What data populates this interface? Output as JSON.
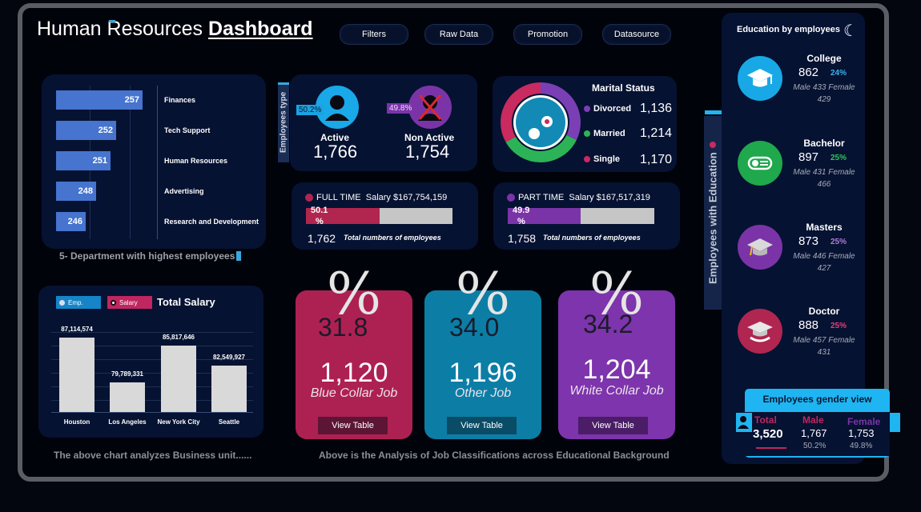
{
  "header": {
    "title_plain": "Human Resources",
    "title_bold": "Dashboard",
    "nav": [
      {
        "label": "Filters"
      },
      {
        "label": "Raw Data"
      },
      {
        "label": "Promotion"
      },
      {
        "label": "Datasource"
      }
    ]
  },
  "departments": {
    "caption": "5- Department with highest employees",
    "items": [
      {
        "name": "Finances",
        "value": "257",
        "count": 257
      },
      {
        "name": "Tech Support",
        "value": "252",
        "count": 252
      },
      {
        "name": "Human Resources",
        "value": "251",
        "count": 251
      },
      {
        "name": "Advertising",
        "value": "248",
        "count": 248
      },
      {
        "name": "Research and Development",
        "value": "246",
        "count": 246
      }
    ]
  },
  "salary_chart": {
    "legend_emp": "Emp.",
    "legend_salary": "Salary",
    "title": "Total Salary",
    "caption": "The above chart analyzes Business unit......"
  },
  "chart_data": {
    "type": "bar",
    "title": "Total Salary",
    "categories": [
      "Houston",
      "Los Angeles",
      "New York City",
      "Seattle"
    ],
    "values": [
      87114574,
      79789331,
      85817646,
      82549927
    ],
    "value_labels": [
      "87,114,574",
      "79,789,331",
      "85,817,646",
      "82,549,927"
    ],
    "ylim": [
      75000000,
      88000000
    ],
    "grid": true
  },
  "employee_type": {
    "tab": "Employees type",
    "active": {
      "label": "Active",
      "value": "1,766",
      "pct": "50.2%"
    },
    "non_active": {
      "label": "Non Active",
      "value": "1,754",
      "pct": "49.8%"
    }
  },
  "marital": {
    "title": "Marital Status",
    "items": [
      {
        "label": "Divorced",
        "value": "1,136",
        "color": "#7b3fb5"
      },
      {
        "label": "Married",
        "value": "1,214",
        "color": "#2db357"
      },
      {
        "label": "Single",
        "value": "1,170",
        "color": "#c92a5f"
      }
    ]
  },
  "full_time": {
    "label": "FULL TIME",
    "salary": "Salary $167,754,159",
    "pct": "50.1",
    "pct_sign": "%",
    "fraction": 0.501,
    "count": "1,762",
    "count_label": "Total numbers of employees",
    "color": "#b0264f"
  },
  "part_time": {
    "label": "PART TIME",
    "salary": "Salary $167,517,319",
    "pct": "49.9",
    "pct_sign": "%",
    "fraction": 0.499,
    "count": "1,758",
    "count_label": "Total numbers of employees",
    "color": "#7a34a8"
  },
  "jobs": {
    "caption": "Above is the Analysis of Job Classifications across Educational Background",
    "symbol": "%",
    "cards": [
      {
        "pct": "31.8",
        "count": "1,120",
        "label": "Blue Collar Job",
        "button": "View Table",
        "color": "#ad2152"
      },
      {
        "pct": "34.0",
        "count": "1,196",
        "label": "Other Job",
        "button": "View Table",
        "color": "#0c7ea6"
      },
      {
        "pct": "34.2",
        "count": "1,204",
        "label": "White Collar Job",
        "button": "View Table",
        "color": "#7d34ac"
      }
    ]
  },
  "education": {
    "title": "Education by employees",
    "tab": "Employees with Education",
    "items": [
      {
        "name": "College",
        "count": "862",
        "pct": "24%",
        "gender": "Male 433 Female 429",
        "color": "#18a8e6",
        "pct_color": "#3ab4ee"
      },
      {
        "name": "Bachelor",
        "count": "897",
        "pct": "25%",
        "gender": "Male 431 Female 466",
        "color": "#1fa84c",
        "pct_color": "#2fc45c"
      },
      {
        "name": "Masters",
        "count": "873",
        "pct": "25%",
        "gender": "Male 446 Female 427",
        "color": "#7a34a8",
        "pct_color": "#b07ad8"
      },
      {
        "name": "Doctor",
        "count": "888",
        "pct": "25%",
        "gender": "Male 457 Female 431",
        "color": "#b02650",
        "pct_color": "#e0407a"
      }
    ]
  },
  "gender_view": {
    "title": "Employees gender view",
    "total_label": "Total",
    "total": "3,520",
    "male_label": "Male",
    "male": "1,767",
    "male_pct": "50.2%",
    "female_label": "Female",
    "female": "1,753",
    "female_pct": "49.8%"
  }
}
